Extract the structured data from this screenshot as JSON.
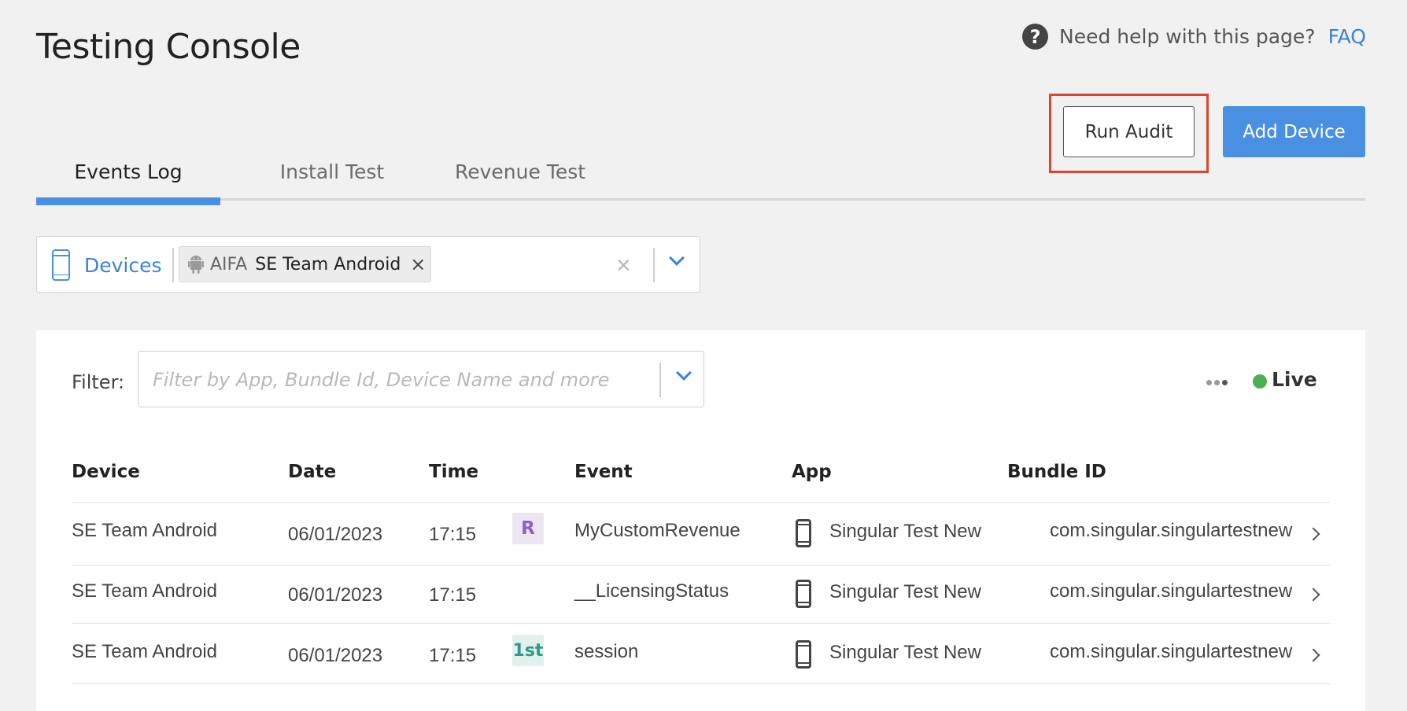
{
  "header": {
    "title": "Testing Console",
    "help_text": "Need help with this page?",
    "help_icon": "question-circle-icon",
    "faq_link": "FAQ"
  },
  "actions": {
    "run_audit": "Run Audit",
    "add_device": "Add Device",
    "highlight_color": "#e0452b",
    "primary_color": "#4a90e2"
  },
  "tabs": [
    {
      "label": "Events Log",
      "active": true
    },
    {
      "label": "Install Test",
      "active": false
    },
    {
      "label": "Revenue Test",
      "active": false
    }
  ],
  "device_picker": {
    "label": "Devices",
    "chip": {
      "icon": "android-icon",
      "prefix": "AIFA",
      "name": "SE Team Android",
      "remove": "×"
    },
    "clear": "×"
  },
  "filter": {
    "label": "Filter:",
    "value": "",
    "placeholder": "Filter by App, Bundle Id, Device Name and more"
  },
  "live": {
    "label": "Live",
    "color": "#4caf50"
  },
  "table": {
    "columns": [
      "Device",
      "Date",
      "Time",
      "Event",
      "App",
      "Bundle ID"
    ],
    "rows": [
      {
        "device": "SE Team Android",
        "date": "06/01/2023",
        "time": "17:15",
        "badge": "R",
        "event": "MyCustomRevenue",
        "app": "Singular Test New",
        "bundle_id": "com.singular.singulartestnew"
      },
      {
        "device": "SE Team Android",
        "date": "06/01/2023",
        "time": "17:15",
        "badge": "",
        "event": "__LicensingStatus",
        "app": "Singular Test New",
        "bundle_id": "com.singular.singulartestnew"
      },
      {
        "device": "SE Team Android",
        "date": "06/01/2023",
        "time": "17:15",
        "badge": "1st",
        "event": "session",
        "app": "Singular Test New",
        "bundle_id": "com.singular.singulartestnew"
      }
    ]
  }
}
